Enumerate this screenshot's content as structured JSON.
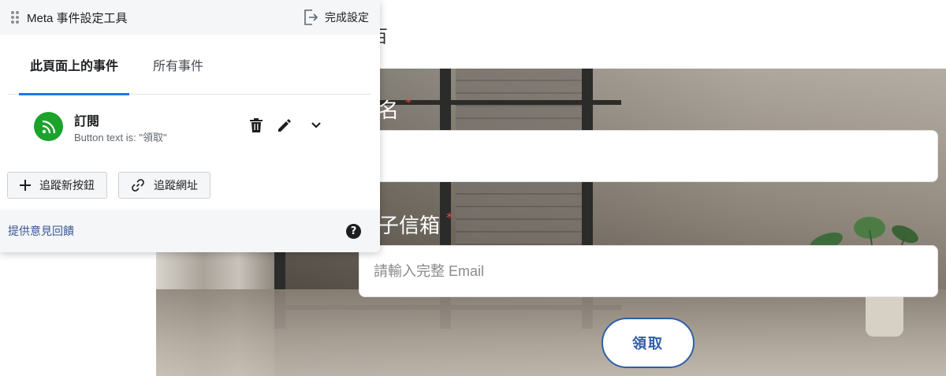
{
  "panel": {
    "title": "Meta 事件設定工具",
    "finish_label": "完成設定",
    "tabs": [
      {
        "label": "此頁面上的事件",
        "active": true
      },
      {
        "label": "所有事件",
        "active": false
      }
    ],
    "events": [
      {
        "name": "訂閱",
        "description": "Button text is: \"領取\"",
        "icon": "rss-icon"
      }
    ],
    "track_new_button_label": "追蹤新按鈕",
    "track_url_label": "追蹤網址",
    "feedback_label": "提供意見回饋",
    "help_glyph": "?"
  },
  "page": {
    "header_fragment": "百",
    "name_label_fragment": "名",
    "email_label_fragment": "子信箱",
    "required_mark": "*",
    "name_value": "",
    "email_placeholder": "請輸入完整 Email",
    "submit_label": "領取"
  },
  "colors": {
    "accent": "#1877f2",
    "event_icon_bg": "#1ba32c",
    "submit_border": "#2f5fa8",
    "required": "#e0524b"
  }
}
